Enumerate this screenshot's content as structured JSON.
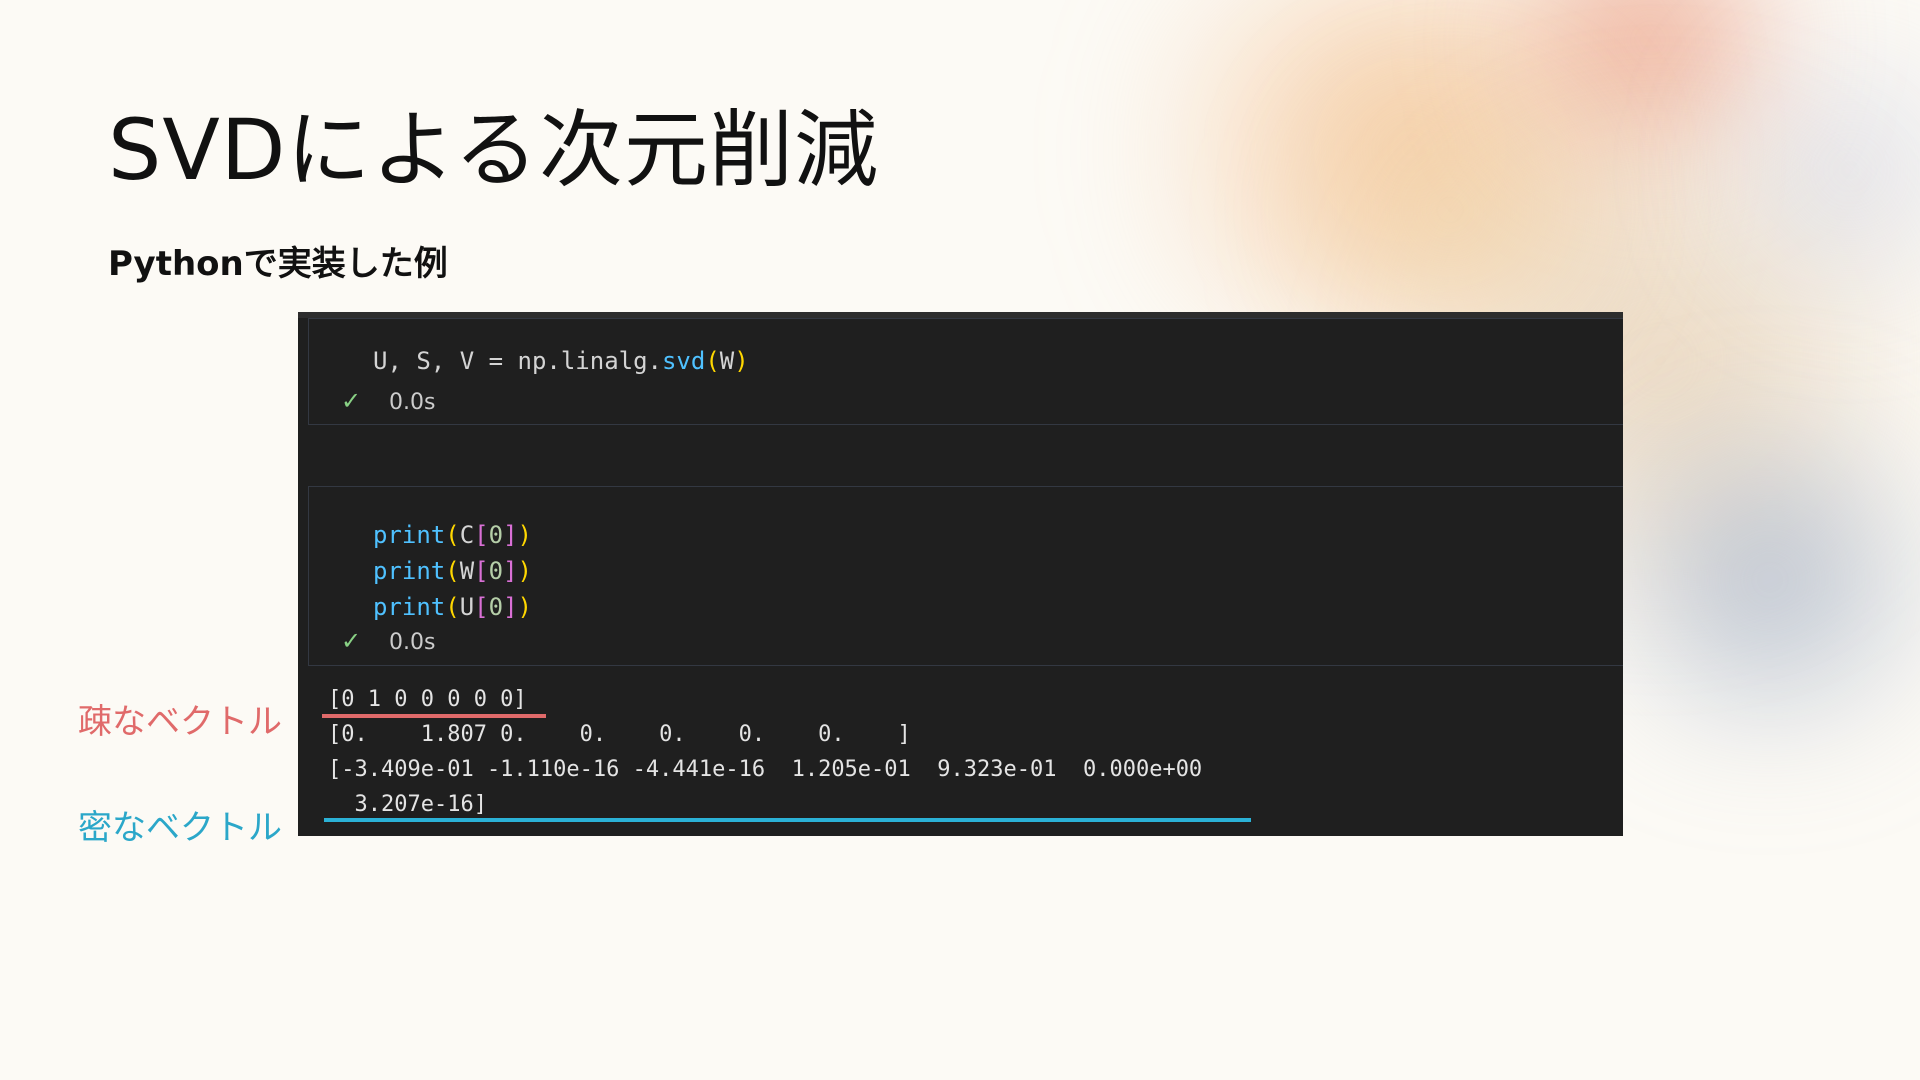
{
  "slide": {
    "title": "SVDによる次元削減",
    "subtitle": "Pythonで実装した例"
  },
  "labels": {
    "sparse": "疎なベクトル",
    "dense": "密なベクトル"
  },
  "cell1": {
    "code": {
      "prefix": "U, S, V = np.linalg.",
      "func": "svd",
      "open": "(",
      "arg": "W",
      "close": ")"
    },
    "status": {
      "check_icon": "✓",
      "time": "0.0s"
    }
  },
  "cell2": {
    "lines": [
      {
        "func": "print",
        "open1": "(",
        "var": "C",
        "open2": "[",
        "index": "0",
        "close2": "]",
        "close1": ")"
      },
      {
        "func": "print",
        "open1": "(",
        "var": "W",
        "open2": "[",
        "index": "0",
        "close2": "]",
        "close1": ")"
      },
      {
        "func": "print",
        "open1": "(",
        "var": "U",
        "open2": "[",
        "index": "0",
        "close2": "]",
        "close1": ")"
      }
    ],
    "status": {
      "check_icon": "✓",
      "time": "0.0s"
    }
  },
  "output": {
    "lines": [
      "[0 1 0 0 0 0 0]",
      "[0.    1.807 0.    0.    0.    0.    0.    ]",
      "[-3.409e-01 -1.110e-16 -4.441e-16  1.205e-01  9.323e-01  0.000e+00",
      "  3.207e-16]"
    ]
  },
  "colors": {
    "sparse_accent": "#e06a6a",
    "dense_accent": "#2ba7c9",
    "panel_bg": "#1f1f1f",
    "function": "#4fc1ff",
    "bracket_outer": "#ffd700",
    "bracket_inner": "#da70d6",
    "success": "#89d185"
  }
}
